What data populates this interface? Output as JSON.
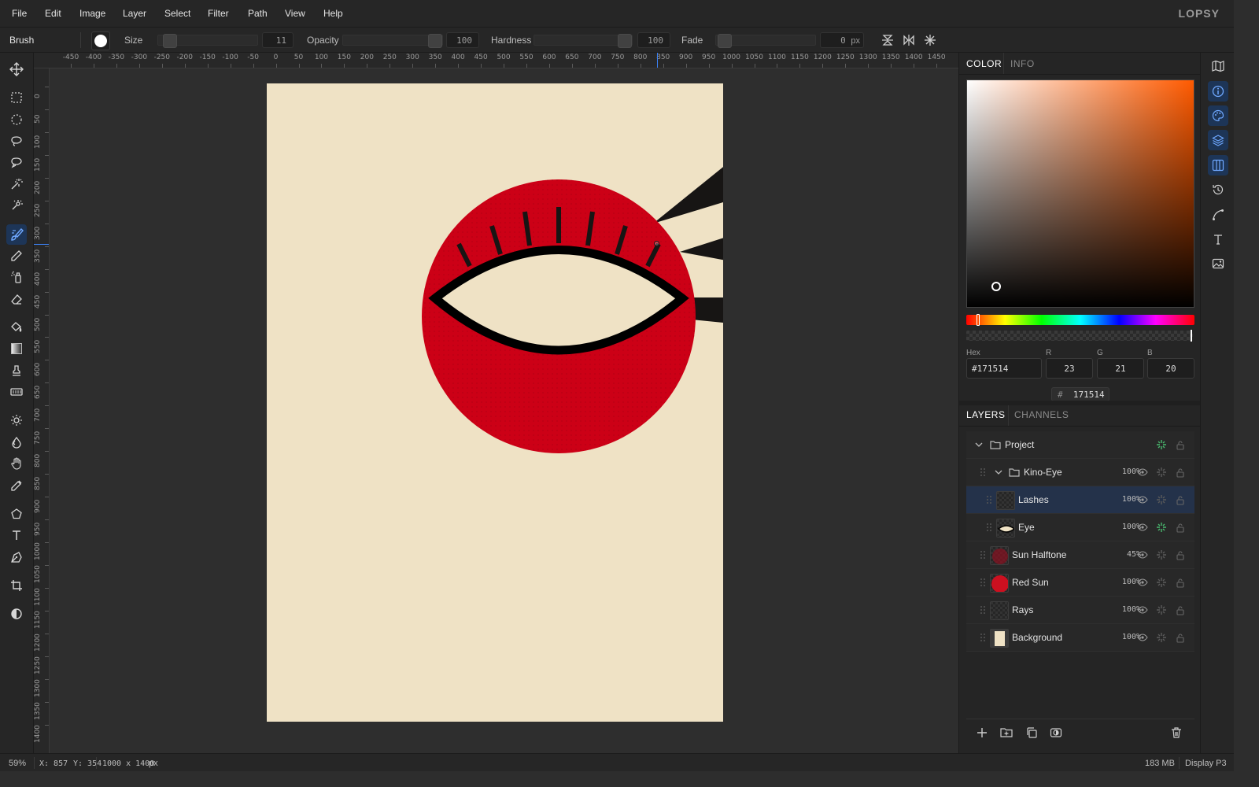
{
  "app": {
    "logo": "LOPSY"
  },
  "menu": [
    "File",
    "Edit",
    "Image",
    "Layer",
    "Select",
    "Filter",
    "Path",
    "View",
    "Help"
  ],
  "options": {
    "tool_name": "Brush",
    "size_label": "Size",
    "size_value": "11",
    "size_level": 0.04,
    "opacity_label": "Opacity",
    "opacity_value": "100",
    "opacity_level": 1.0,
    "hardness_label": "Hardness",
    "hardness_value": "100",
    "hardness_level": 1.0,
    "fade_label": "Fade",
    "fade_value": "0",
    "fade_unit": "px",
    "fade_level": 0.0
  },
  "rulers": {
    "h_ticks": [
      "-450",
      "-400",
      "-350",
      "-300",
      "-250",
      "-200",
      "-150",
      "-100",
      "-50",
      "0",
      "50",
      "100",
      "150",
      "200",
      "250",
      "300",
      "350",
      "400",
      "450",
      "500",
      "550",
      "600",
      "650",
      "700",
      "750",
      "800",
      "850",
      "900",
      "950",
      "1000",
      "1050",
      "1100",
      "1150",
      "1200",
      "1250",
      "1300",
      "1350",
      "1400",
      "1450"
    ],
    "v_ticks": [
      "0",
      "50",
      "100",
      "150",
      "200",
      "250",
      "300",
      "350",
      "400",
      "450",
      "500",
      "550",
      "600",
      "650",
      "700",
      "750",
      "800",
      "850",
      "900",
      "950",
      "1000",
      "1050",
      "1100",
      "1150",
      "1200",
      "1250",
      "1300",
      "1350",
      "1400"
    ]
  },
  "tools": [
    "move-icon",
    "rect-select-icon",
    "ellipse-select-icon",
    "lasso-icon",
    "magnetic-lasso-icon",
    "magic-wand-icon",
    "quick-select-icon",
    "brush-icon",
    "pencil-icon",
    "spray-icon",
    "eraser-icon",
    "fill-bucket-icon",
    "gradient-icon",
    "stamp-icon",
    "patch-icon",
    "dodge-icon",
    "burn-icon",
    "smudge-icon",
    "eyedropper-icon",
    "polygon-icon",
    "text-icon",
    "pen-icon",
    "crop-icon",
    "contrast-icon"
  ],
  "right_tools": [
    "map-icon",
    "info-icon",
    "palette-icon",
    "layers-icon",
    "columns-icon",
    "history-icon",
    "curve-icon",
    "type-icon",
    "image-icon"
  ],
  "color_panel": {
    "tab_color": "COLOR",
    "tab_info": "INFO",
    "hex_label": "Hex",
    "hex_value": "#171514",
    "r_label": "R",
    "r_value": "23",
    "g_label": "G",
    "g_value": "21",
    "b_label": "B",
    "b_value": "20",
    "hex_chip": "171514",
    "current_color": "#171514",
    "hue_color": "#ff5a00"
  },
  "layers_panel": {
    "tab_layers": "LAYERS",
    "tab_channels": "CHANNELS",
    "layers": [
      {
        "name": "Project",
        "opacity": "",
        "type": "group"
      },
      {
        "name": "Kino-Eye",
        "opacity": "100%",
        "type": "group"
      },
      {
        "name": "Lashes",
        "opacity": "100%",
        "type": "layer",
        "selected": true
      },
      {
        "name": "Eye",
        "opacity": "100%",
        "type": "layer"
      },
      {
        "name": "Sun Halftone",
        "opacity": "45%",
        "type": "layer"
      },
      {
        "name": "Red Sun",
        "opacity": "100%",
        "type": "layer"
      },
      {
        "name": "Rays",
        "opacity": "100%",
        "type": "layer"
      },
      {
        "name": "Background",
        "opacity": "100%",
        "type": "layer"
      }
    ]
  },
  "canvas": {
    "background_color": "#efe2c5",
    "sun_color": "#cc0016",
    "ink_color": "#171514"
  },
  "status": {
    "zoom": "59%",
    "cursor_x": "X: 857",
    "cursor_y": "Y: 354",
    "doc_size": "1000 x 1400",
    "doc_unit": "px",
    "memory": "183 MB",
    "color_profile": "Display P3"
  }
}
